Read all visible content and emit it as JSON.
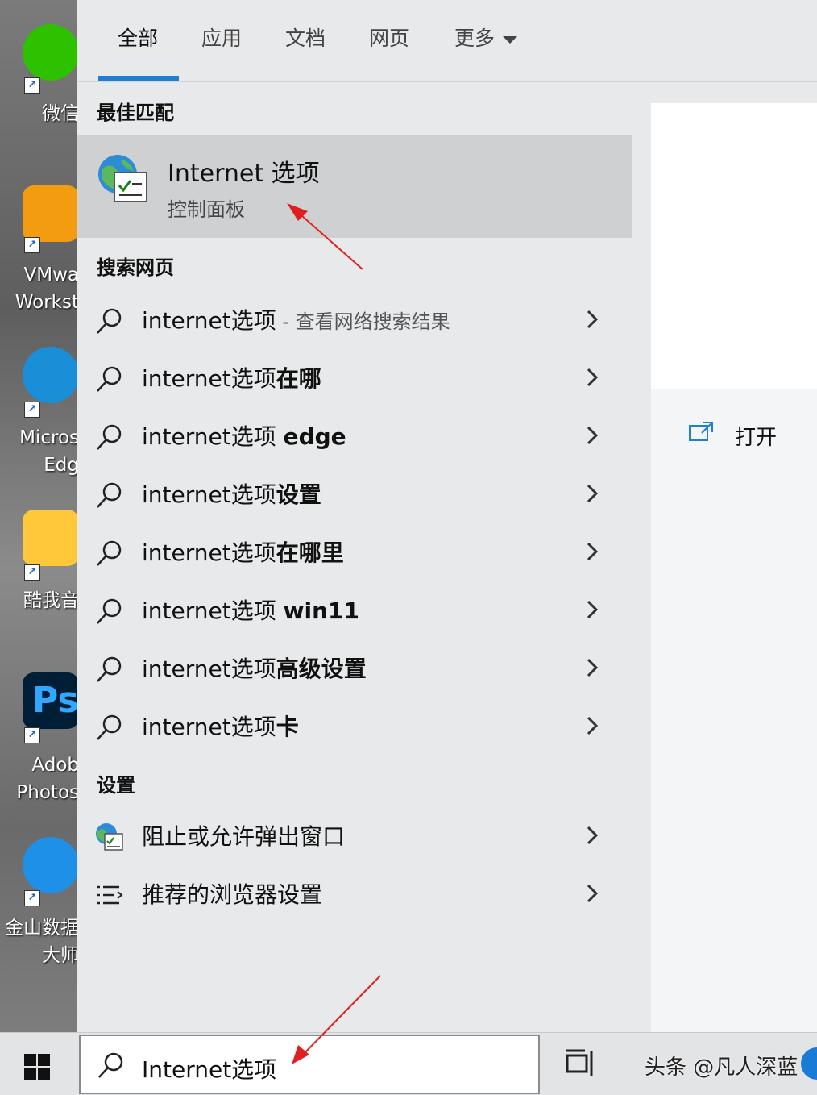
{
  "desktop": {
    "icons": [
      {
        "label": "微信",
        "name": "wechat"
      },
      {
        "label": "VMwa\nWorkst",
        "name": "vmware"
      },
      {
        "label": "Micros\nEdg",
        "name": "edge"
      },
      {
        "label": "酷我音",
        "name": "kuwo"
      },
      {
        "label": "Adob\nPhotos",
        "name": "photoshop"
      },
      {
        "label": "金山数据\n大师",
        "name": "kingsoft-data"
      }
    ],
    "ps_glyph": "Ps"
  },
  "tabs": [
    {
      "label": "全部",
      "active": true
    },
    {
      "label": "应用",
      "active": false
    },
    {
      "label": "文档",
      "active": false
    },
    {
      "label": "网页",
      "active": false
    },
    {
      "label": "更多",
      "active": false
    }
  ],
  "sections": {
    "best_match": "最佳匹配",
    "search_web": "搜索网页",
    "settings": "设置"
  },
  "best_match": {
    "title": "Internet 选项",
    "subtitle": "控制面板"
  },
  "web_results": [
    {
      "prefix": "internet选项",
      "suffix": "",
      "hint": " - 查看网络搜索结果"
    },
    {
      "prefix": "internet选项",
      "suffix": "在哪",
      "hint": ""
    },
    {
      "prefix": "internet选项 ",
      "suffix": "edge",
      "hint": ""
    },
    {
      "prefix": "internet选项",
      "suffix": "设置",
      "hint": ""
    },
    {
      "prefix": "internet选项",
      "suffix": "在哪里",
      "hint": ""
    },
    {
      "prefix": "internet选项 ",
      "suffix": "win11",
      "hint": ""
    },
    {
      "prefix": "internet选项",
      "suffix": "高级设置",
      "hint": ""
    },
    {
      "prefix": "internet选项",
      "suffix": "卡",
      "hint": ""
    }
  ],
  "settings_results": [
    {
      "label": "阻止或允许弹出窗口",
      "icon": "internet-options-icon"
    },
    {
      "label": "推荐的浏览器设置",
      "icon": "list-settings-icon"
    }
  ],
  "preview": {
    "open_label": "打开"
  },
  "taskbar": {
    "search_value": "Internet选项",
    "watermark": "头条 @凡人深蓝"
  },
  "colors": {
    "accent": "#1f7fd6",
    "annotation_arrow": "#e02020"
  }
}
